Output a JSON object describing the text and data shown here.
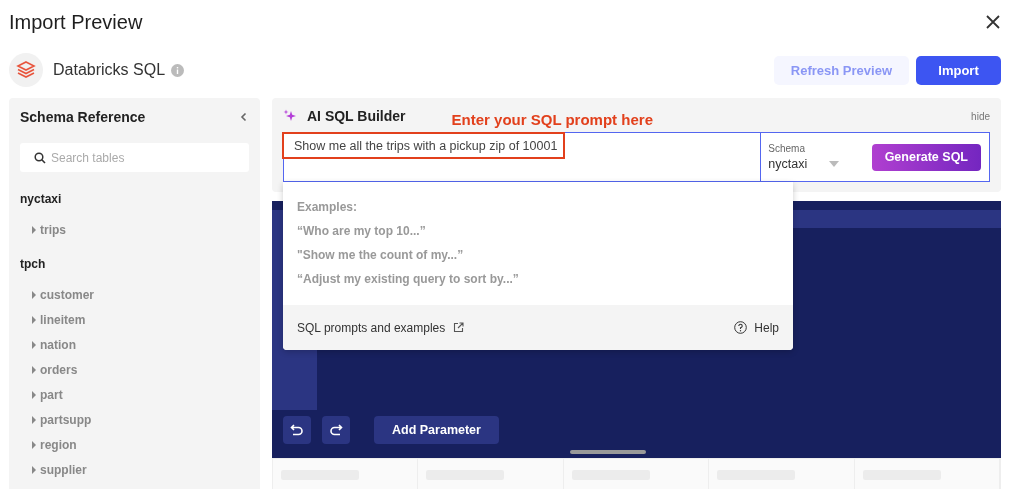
{
  "window": {
    "title": "Import Preview"
  },
  "source": {
    "name": "Databricks SQL"
  },
  "actions": [
    {
      "label": "Refresh Preview",
      "kind": "secondary",
      "disabled": true
    },
    {
      "label": "Import",
      "kind": "primary",
      "disabled": false
    }
  ],
  "sidebar": {
    "title": "Schema Reference",
    "search": {
      "placeholder": "Search tables"
    },
    "schemas": [
      {
        "name": "nyctaxi",
        "children": [
          {
            "name": "trips",
            "expanded": false
          }
        ]
      },
      {
        "name": "tpch",
        "children": [
          {
            "name": "customer",
            "expanded": false
          },
          {
            "name": "lineitem",
            "expanded": false
          },
          {
            "name": "nation",
            "expanded": false
          },
          {
            "name": "orders",
            "expanded": false
          },
          {
            "name": "part",
            "expanded": false
          },
          {
            "name": "partsupp",
            "expanded": false
          },
          {
            "name": "region",
            "expanded": false
          },
          {
            "name": "supplier",
            "expanded": false
          }
        ]
      }
    ]
  },
  "ai_builder": {
    "title": "AI SQL Builder",
    "annotation": "Enter your SQL prompt here",
    "hide": "hide",
    "prompt": {
      "value": "Show me all the trips with a pickup zip of 10001"
    },
    "schema": {
      "label": "Schema",
      "value": "nyctaxi"
    },
    "generate": "Generate SQL"
  },
  "suggestions": {
    "heading": "Examples:",
    "examples": [
      "“Who are my top 10...”",
      "\"Show me the count of my...”",
      "“Adjust my existing query to sort by...”"
    ],
    "link": "SQL prompts and examples",
    "help": "Help"
  },
  "editor": {
    "add_parameter": "Add Parameter"
  }
}
